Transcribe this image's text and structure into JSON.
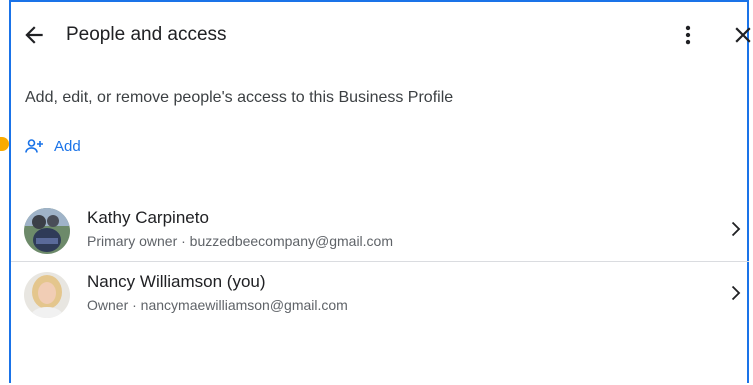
{
  "header": {
    "title": "People and access",
    "back_icon": "arrow-back-icon",
    "more_icon": "more-vert-icon",
    "close_icon": "close-icon"
  },
  "description": "Add, edit, or remove people's access to this Business Profile",
  "add_button": {
    "label": "Add",
    "icon": "person-add-icon"
  },
  "people": [
    {
      "name": "Kathy Carpineto",
      "meta": "Primary owner · buzzedbeecompany@gmail.com"
    },
    {
      "name": "Nancy Williamson (you)",
      "meta": "Owner · nancymaewilliamson@gmail.com"
    }
  ],
  "colors": {
    "accent": "#1a73e8",
    "highlight": "#f9ab00",
    "divider": "#dadce0"
  }
}
